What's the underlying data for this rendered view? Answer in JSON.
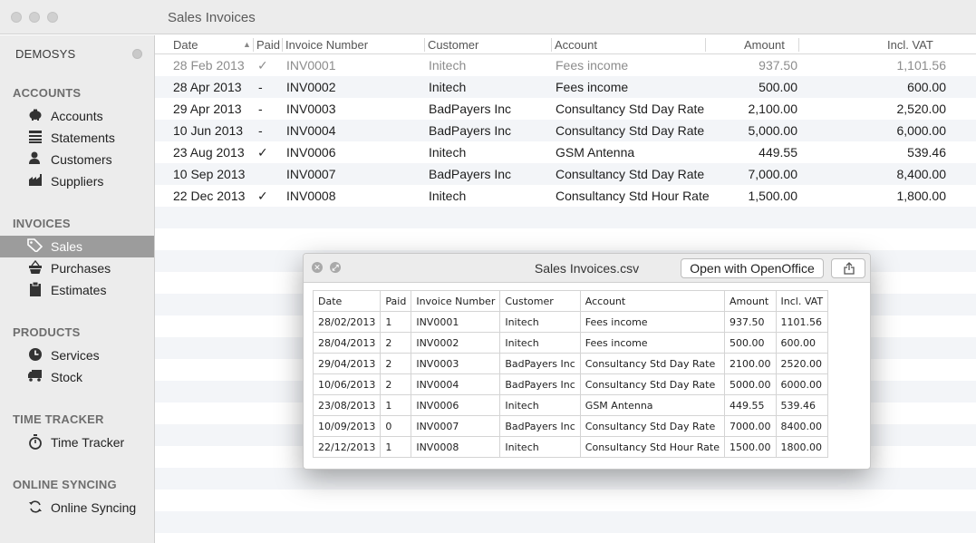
{
  "window": {
    "title": "Sales Invoices"
  },
  "sidebar": {
    "company": "DEMOSYS",
    "sections": [
      {
        "title": "ACCOUNTS",
        "items": [
          {
            "label": "Accounts",
            "icon": "piggy-bank-icon"
          },
          {
            "label": "Statements",
            "icon": "statement-icon"
          },
          {
            "label": "Customers",
            "icon": "customer-icon"
          },
          {
            "label": "Suppliers",
            "icon": "supplier-icon"
          }
        ]
      },
      {
        "title": "INVOICES",
        "items": [
          {
            "label": "Sales",
            "icon": "tag-icon",
            "selected": true
          },
          {
            "label": "Purchases",
            "icon": "basket-icon"
          },
          {
            "label": "Estimates",
            "icon": "clipboard-icon"
          }
        ]
      },
      {
        "title": "PRODUCTS",
        "items": [
          {
            "label": "Services",
            "icon": "clock-icon"
          },
          {
            "label": "Stock",
            "icon": "truck-icon"
          }
        ]
      },
      {
        "title": "TIME TRACKER",
        "items": [
          {
            "label": "Time Tracker",
            "icon": "stopwatch-icon"
          }
        ]
      },
      {
        "title": "ONLINE SYNCING",
        "items": [
          {
            "label": "Online Syncing",
            "icon": "sync-icon"
          }
        ]
      }
    ]
  },
  "table": {
    "columns": [
      "Date",
      "Paid",
      "Invoice Number",
      "Customer",
      "Account",
      "Amount",
      "Incl. VAT"
    ],
    "sort_indicator": "▲",
    "rows": [
      {
        "date": "28 Feb 2013",
        "paid": "✓",
        "invoice": "INV0001",
        "customer": "Initech",
        "account": "Fees income",
        "amount": "937.50",
        "vat": "1,101.56"
      },
      {
        "date": "28 Apr 2013",
        "paid": "-",
        "invoice": "INV0002",
        "customer": "Initech",
        "account": "Fees income",
        "amount": "500.00",
        "vat": "600.00"
      },
      {
        "date": "29 Apr 2013",
        "paid": "-",
        "invoice": "INV0003",
        "customer": "BadPayers Inc",
        "account": "Consultancy Std Day Rate",
        "amount": "2,100.00",
        "vat": "2,520.00"
      },
      {
        "date": "10 Jun 2013",
        "paid": "-",
        "invoice": "INV0004",
        "customer": "BadPayers Inc",
        "account": "Consultancy Std Day Rate",
        "amount": "5,000.00",
        "vat": "6,000.00"
      },
      {
        "date": "23 Aug 2013",
        "paid": "✓",
        "invoice": "INV0006",
        "customer": "Initech",
        "account": "GSM Antenna",
        "amount": "449.55",
        "vat": "539.46"
      },
      {
        "date": "10 Sep 2013",
        "paid": "",
        "invoice": "INV0007",
        "customer": "BadPayers Inc",
        "account": "Consultancy Std Day Rate",
        "amount": "7,000.00",
        "vat": "8,400.00"
      },
      {
        "date": "22 Dec 2013",
        "paid": "✓",
        "invoice": "INV0008",
        "customer": "Initech",
        "account": "Consultancy Std Hour Rate",
        "amount": "1,500.00",
        "vat": "1,800.00"
      }
    ]
  },
  "preview": {
    "title": "Sales Invoices.csv",
    "open_label": "Open with OpenOffice",
    "csv": [
      [
        "Date",
        "Paid",
        "Invoice Number",
        "Customer",
        "Account",
        "Amount",
        "Incl. VAT"
      ],
      [
        "28/02/2013",
        "1",
        "INV0001",
        "Initech",
        "Fees income",
        "937.50",
        "1101.56"
      ],
      [
        "28/04/2013",
        "2",
        "INV0002",
        "Initech",
        "Fees income",
        "500.00",
        "600.00"
      ],
      [
        "29/04/2013",
        "2",
        "INV0003",
        "BadPayers Inc",
        "Consultancy Std Day Rate",
        "2100.00",
        "2520.00"
      ],
      [
        "10/06/2013",
        "2",
        "INV0004",
        "BadPayers Inc",
        "Consultancy Std Day Rate",
        "5000.00",
        "6000.00"
      ],
      [
        "23/08/2013",
        "1",
        "INV0006",
        "Initech",
        "GSM Antenna",
        "449.55",
        "539.46"
      ],
      [
        "10/09/2013",
        "0",
        "INV0007",
        "BadPayers Inc",
        "Consultancy Std Day Rate",
        "7000.00",
        "8400.00"
      ],
      [
        "22/12/2013",
        "1",
        "INV0008",
        "Initech",
        "Consultancy Std Hour Rate",
        "1500.00",
        "1800.00"
      ]
    ]
  }
}
